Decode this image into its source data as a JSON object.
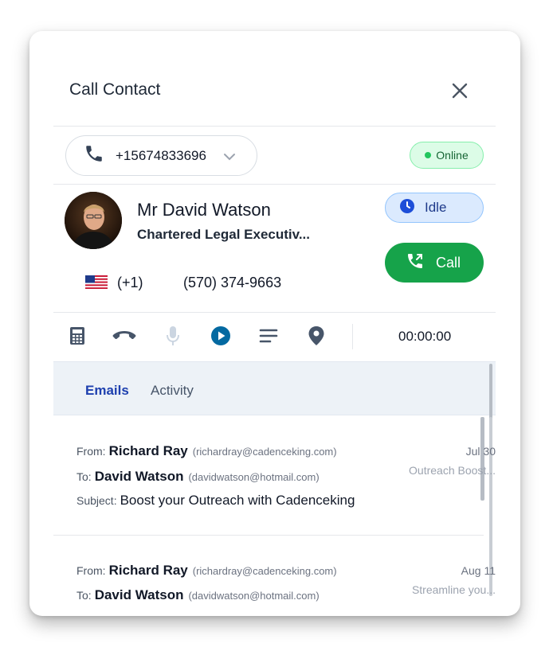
{
  "dialog": {
    "title": "Call Contact"
  },
  "caller_id": {
    "number": "+15674833696"
  },
  "status": {
    "online_label": "Online"
  },
  "contact": {
    "name": "Mr David Watson",
    "job_title": "Chartered Legal Executiv...",
    "country_code": "(+1)",
    "phone": "(570) 374-9663"
  },
  "actions": {
    "idle_label": "Idle",
    "call_label": "Call"
  },
  "toolbar": {
    "timer": "00:00:00"
  },
  "tabs": [
    {
      "label": "Emails",
      "active": true
    },
    {
      "label": "Activity",
      "active": false
    }
  ],
  "emails": [
    {
      "from_label": "From:",
      "from_name": "Richard Ray",
      "from_addr": "(richardray@cadenceking.com)",
      "to_label": "To:",
      "to_name": "David Watson",
      "to_addr": "(davidwatson@hotmail.com)",
      "subject_label": "Subject:",
      "subject": "Boost your Outreach with Cadenceking",
      "date": "Jul 30",
      "snippet": "Outreach Boost..."
    },
    {
      "from_label": "From:",
      "from_name": "Richard Ray",
      "from_addr": "(richardray@cadenceking.com)",
      "to_label": "To:",
      "to_name": "David Watson",
      "to_addr": "(davidwatson@hotmail.com)",
      "date": "Aug 11",
      "snippet": "Streamline you..."
    }
  ],
  "colors": {
    "accent_blue": "#1e40af",
    "call_green": "#16a34a",
    "online_green": "#22c55e"
  }
}
